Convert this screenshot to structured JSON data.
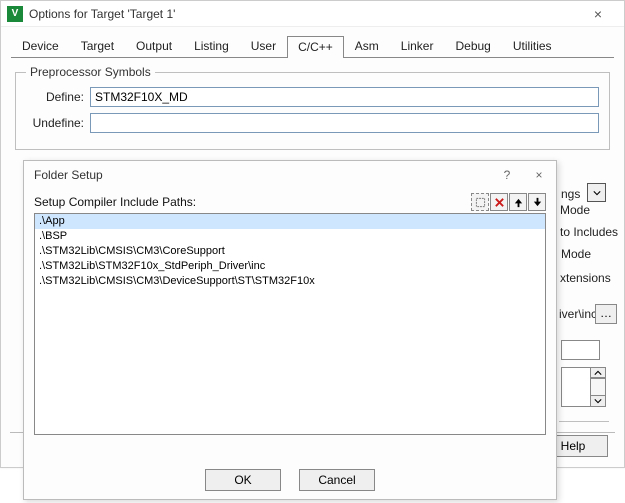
{
  "main_window": {
    "title": "Options for Target 'Target 1'",
    "icon_letter": "V",
    "tabs": [
      "Device",
      "Target",
      "Output",
      "Listing",
      "User",
      "C/C++",
      "Asm",
      "Linker",
      "Debug",
      "Utilities"
    ],
    "active_tab_index": 5,
    "preproc": {
      "legend": "Preprocessor Symbols",
      "define_label": "Define:",
      "define_value": "STM32F10X_MD",
      "undefine_label": "Undefine:",
      "undefine_value": ""
    },
    "fragments": {
      "ngs": "ngs",
      "mode1": " Mode",
      "to_includes": "to Includes",
      "mode2": "Mode",
      "extensions": "xtensions",
      "iver_inc": "iver\\inc"
    },
    "help_label": "Help"
  },
  "folder_window": {
    "title": "Folder Setup",
    "help_glyph": "?",
    "close_glyph": "×",
    "paths_label": "Setup Compiler Include Paths:",
    "toolbar_icons": [
      "new",
      "delete",
      "move-up",
      "move-down"
    ],
    "paths": [
      ".\\App",
      ".\\BSP",
      ".\\STM32Lib\\CMSIS\\CM3\\CoreSupport",
      ".\\STM32Lib\\STM32F10x_StdPeriph_Driver\\inc",
      ".\\STM32Lib\\CMSIS\\CM3\\DeviceSupport\\ST\\STM32F10x"
    ],
    "selected_index": 0,
    "buttons": {
      "ok": "OK",
      "cancel": "Cancel"
    }
  }
}
